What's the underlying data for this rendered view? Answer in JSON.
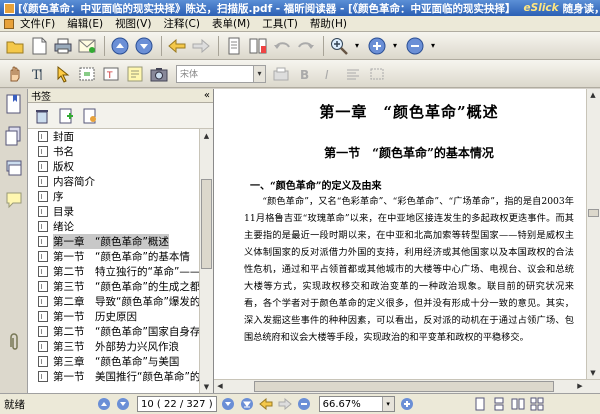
{
  "window": {
    "title": "[《颜色革命：中亚面临的现实抉择》陈达，扫描版.pdf - 福昕阅读器 - [《颜色革命：中亚面临的现实抉择】",
    "brand": "eSlick",
    "slogan": "随身读，读遍天下书！"
  },
  "menu": {
    "items": [
      "文件(F)",
      "编辑(E)",
      "视图(V)",
      "注释(C)",
      "表单(M)",
      "工具(T)",
      "帮助(H)"
    ]
  },
  "toolbar2": {
    "font_placeholder": "宋体"
  },
  "bookmarks": {
    "header": "书签",
    "collapse_glyph": "«",
    "items": [
      "封面",
      "书名",
      "版权",
      "内容简介",
      "序",
      "目录",
      "绪论",
      "第一章　“颜色革命”概述",
      "第一节　“颜色革命”的基本情",
      "第二节　特立独行的“革命”——",
      "第三节　“颜色革命”的生成之都",
      "第二章　导致“颜色革命”爆发的",
      "第一节　历史原因",
      "第二节　“颜色革命”国家自身存",
      "第三节　外部势力兴风作浪",
      "第三章　“颜色革命”与美国",
      "第一节　美国推行“颜色革命”的"
    ],
    "selected_index": 7
  },
  "document": {
    "chapter_title": "第一章　“颜色革命”概述",
    "section_title": "第一节　“颜色革命”的基本情况",
    "subsection_title": "一、“颜色革命”的定义及由来",
    "para1": "“颜色革命”，又名“色彩革命”、“彩色革命”、“广场革命”，指的是自2003年11月格鲁吉亚“玫瑰革命”以来，在中亚地区接连发生的多起政权更迭事件。而其主要指的是最近一段时期以来，在中亚和北高加索等转型国家——特别是威权主义体制国家的反对派借力外国的支持，利用经济或其他国家以及本国政权的合法性危机，通过和平占领首都或其他城市的大楼等中心广场、电视台、议会和总统大楼等方式，实现政权移交和政治变革的一种政治现象。联目前的研究状况来看，各个学者对于颜色革命的定义很多，但并没有形成十分一致的意见。其实，深入发掘这些事件的种种因素，可以看出，反对派的动机在于通过占领广场、包围总统府和议会大楼等手段，实现政治的和平变革和政权的平稳移交。"
  },
  "status": {
    "text": "就绪",
    "page_display": "10 ( 22 / 327 )",
    "zoom_display": "66.67%"
  }
}
